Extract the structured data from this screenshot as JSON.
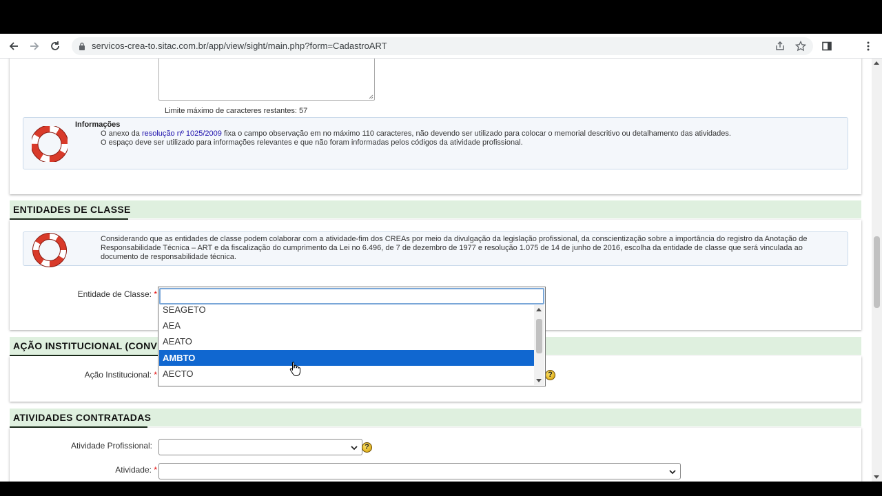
{
  "browser": {
    "url": "servicos-crea-to.sitac.com.br/app/view/sight/main.php?form=CadastroART"
  },
  "observacao": {
    "char_limit_text": "Limite máximo de caracteres restantes: 57"
  },
  "info_box": {
    "title": "Informações",
    "line1_prefix": "O anexo da ",
    "line1_link": "resolução nº 1025/2009",
    "line1_suffix": " fixa o campo observação em no máximo 110 caracteres, não devendo ser utilizado para colocar o memorial descritivo ou detalhamento das atividades.",
    "line2": "O espaço deve ser utilizado para informações relevantes e que não foram informadas pelos códigos da atividade profissional."
  },
  "entidades": {
    "title": "ENTIDADES DE CLASSE",
    "info_text": "Considerando que as entidades de classe podem colaborar com a atividade-fim dos CREAs por meio da divulgação da legislação profissional, da conscientização sobre a importância do registro da Anotação de Responsabilidade Técnica – ART e da fiscalização do cumprimento da Lei no 6.496, de 7 de dezembro de 1977 e resolução 1.075 de 14 de junho de 2016, escolha da entidade de classe que será vinculada ao documento de responsabilidade técnica.",
    "field_label": "Entidade de Classe:",
    "required_mark": "*",
    "options": [
      "SEAGETO",
      "AEA",
      "AEATO",
      "AMBTO",
      "AECTO"
    ],
    "selected_option": "AMBTO"
  },
  "acao": {
    "title": "AÇÃO INSTITUCIONAL (CONVÊ",
    "field_label": "Ação Institucional:",
    "required_mark": "*"
  },
  "atividades": {
    "title": "ATIVIDADES CONTRATADAS",
    "atividade_profissional_label": "Atividade Profissional:",
    "atividade_label": "Atividade:",
    "required_mark": "*"
  },
  "help_icon_text": "?",
  "colors": {
    "section_bg": "#dff0df",
    "selected_option_bg": "#1067d0",
    "link": "#1a0dab",
    "required": "#e00000"
  },
  "icons": [
    "back-icon",
    "forward-icon",
    "reload-icon",
    "lock-icon",
    "share-icon",
    "star-icon",
    "side-panel-icon",
    "menu-icon",
    "lifebuoy-icon",
    "help-icon",
    "cursor-hand-icon"
  ]
}
